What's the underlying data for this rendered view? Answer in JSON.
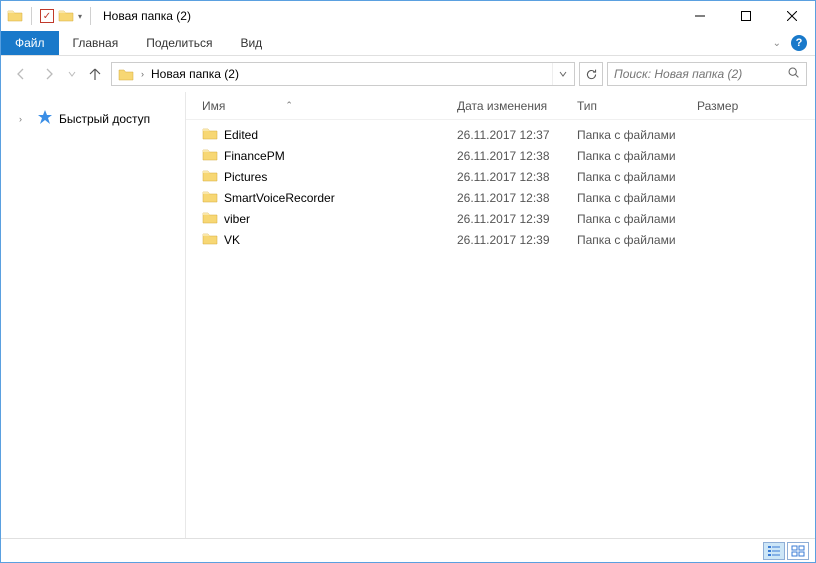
{
  "window": {
    "title": "Новая папка (2)"
  },
  "ribbon": {
    "file": "Файл",
    "home": "Главная",
    "share": "Поделиться",
    "view": "Вид"
  },
  "address": {
    "crumb1": "Новая папка (2)"
  },
  "search": {
    "placeholder": "Поиск: Новая папка (2)"
  },
  "sidebar": {
    "quick_access": "Быстрый доступ"
  },
  "columns": {
    "name": "Имя",
    "date": "Дата изменения",
    "type": "Тип",
    "size": "Размер"
  },
  "items": [
    {
      "name": "Edited",
      "date": "26.11.2017 12:37",
      "type": "Папка с файлами",
      "size": ""
    },
    {
      "name": "FinancePM",
      "date": "26.11.2017 12:38",
      "type": "Папка с файлами",
      "size": ""
    },
    {
      "name": "Pictures",
      "date": "26.11.2017 12:38",
      "type": "Папка с файлами",
      "size": ""
    },
    {
      "name": "SmartVoiceRecorder",
      "date": "26.11.2017 12:38",
      "type": "Папка с файлами",
      "size": ""
    },
    {
      "name": "viber",
      "date": "26.11.2017 12:39",
      "type": "Папка с файлами",
      "size": ""
    },
    {
      "name": "VK",
      "date": "26.11.2017 12:39",
      "type": "Папка с файлами",
      "size": ""
    }
  ]
}
